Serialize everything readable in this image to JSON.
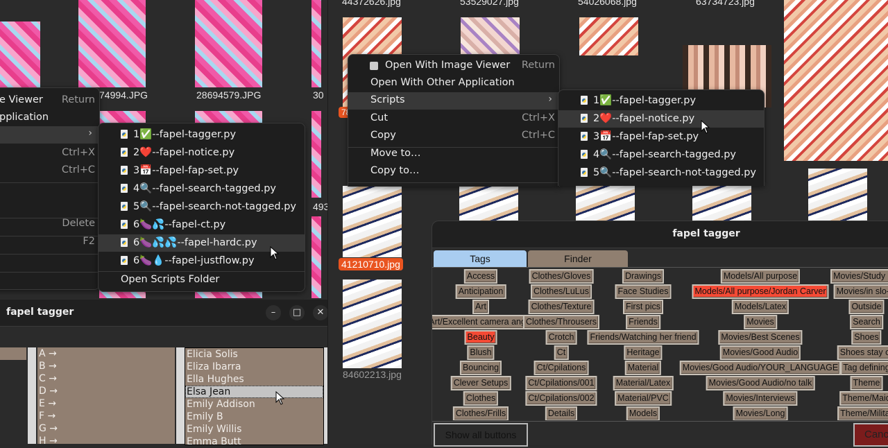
{
  "left_file_manager": {
    "file_labels": [
      "74994.JPG",
      "28694579.JPG",
      "30",
      "493"
    ],
    "context_menu": {
      "items": [
        {
          "label": "e Viewer",
          "accel": "Return"
        },
        {
          "label": "pplication",
          "accel": ""
        },
        {
          "label": "",
          "accel": ""
        },
        {
          "label": "",
          "accel": "Ctrl+X"
        },
        {
          "label": "",
          "accel": "Ctrl+C"
        },
        {
          "label": "",
          "accel": ""
        },
        {
          "label": "",
          "accel": "Delete"
        },
        {
          "label": "",
          "accel": "F2"
        }
      ]
    },
    "scripts_submenu": {
      "items": [
        {
          "label": "1✅--fapel-tagger.py"
        },
        {
          "label": "2❤️--fapel-notice.py"
        },
        {
          "label": "3📅--fapel-fap-set.py"
        },
        {
          "label": "4🔍--fapel-search-tagged.py"
        },
        {
          "label": "5🔍--fapel-search-not-tagged.py"
        },
        {
          "label": "6🍆💦--fapel-ct.py"
        },
        {
          "label": "6🍆💦💦--fapel-hardc.py"
        },
        {
          "label": "6🍆💧--fapel-justflow.py"
        }
      ],
      "footer": "Open Scripts Folder",
      "highlighted_index": 6
    }
  },
  "left_tagger": {
    "title": "fapel tagger",
    "letters": [
      "A →",
      "B →",
      "C →",
      "D →",
      "E →",
      "F →",
      "G →",
      "H →"
    ],
    "names": [
      "Elicia Solis",
      "Eliza Ibarra",
      "Ella Hughes",
      "Elsa Jean",
      "Emily Addison",
      "Emily B",
      "Emily Willis",
      "Emma Butt"
    ],
    "selected_name_index": 3,
    "window_buttons": {
      "minimize": "–",
      "maximize": "□",
      "close": "✕"
    }
  },
  "right_file_manager": {
    "top_labels": [
      "44372626.jpg",
      "53529027.jpg",
      "54026068.jpg",
      "63734723.jpg"
    ],
    "selected_label_fragment": "78",
    "selected_file": "41210710.jpg",
    "other_file": "84602213.jpg",
    "context_menu": {
      "items": [
        {
          "label": "Open With Image Viewer",
          "accel": "Return"
        },
        {
          "label": "Open With Other Application",
          "accel": ""
        },
        {
          "label": "Scripts",
          "accel": ""
        },
        {
          "label": "Cut",
          "accel": "Ctrl+X"
        },
        {
          "label": "Copy",
          "accel": "Ctrl+C"
        },
        {
          "label": "Move to…",
          "accel": ""
        },
        {
          "label": "Copy to…",
          "accel": ""
        }
      ]
    },
    "scripts_submenu": {
      "items": [
        {
          "label": "1✅--fapel-tagger.py"
        },
        {
          "label": "2❤️--fapel-notice.py"
        },
        {
          "label": "3📅--fapel-fap-set.py"
        },
        {
          "label": "4🔍--fapel-search-tagged.py"
        },
        {
          "label": "5🔍--fapel-search-not-tagged.py"
        }
      ],
      "highlighted_index": 1
    }
  },
  "right_tagger": {
    "title": "fapel tagger",
    "tabs": [
      {
        "label": "Tags",
        "active": true
      },
      {
        "label": "Finder",
        "active": false
      }
    ],
    "columns": [
      [
        "Access",
        "Anticipation",
        "Art",
        "Art/Excellent camera angle",
        "Beauty",
        "Blush",
        "Bouncing",
        "Clever Setups",
        "Clothes",
        "Clothes/Frills"
      ],
      [
        "Clothes/Gloves",
        "Clothes/LuLus",
        "Clothes/Texture",
        "Clothes/Throusers",
        "Crotch",
        "Ct",
        "Ct/Cpilations",
        "Ct/Cpilations/001",
        "Ct/Cpilations/002",
        "Details"
      ],
      [
        "Drawings",
        "Face Studies",
        "First pics",
        "Friends",
        "Friends/Watching her friend",
        "Heritage",
        "Material",
        "Material/Latex",
        "Material/PVC",
        "Models"
      ],
      [
        "Models/All purpose",
        "Models/All purpose/Jordan Carver",
        "Models/Latex",
        "Movies",
        "Movies/Best Scenes",
        "Movies/Good Audio",
        "Movies/Good Audio/YOUR_LANGUAGE",
        "Movies/Good Audio/no talk",
        "Movies/Interviews",
        "Movies/Long"
      ],
      [
        "Movies/Study Ma",
        "Movies/in slo-m",
        "Outside",
        "Search",
        "Shoes",
        "Shoes stay or",
        "Tag defining",
        "Theme",
        "Theme/Maid",
        "Theme/Militar"
      ]
    ],
    "active_tags": [
      "Beauty",
      "Models/All purpose/Jordan Carver"
    ],
    "show_all_label": "Show all buttons",
    "cancel_label": "Cance",
    "colors": {
      "tag_bg": "#907f70",
      "tag_active": "#f54a35",
      "tab_active": "#a9cdf0",
      "tab_inactive": "#907f70",
      "cancel": "#7b1c1c"
    }
  }
}
